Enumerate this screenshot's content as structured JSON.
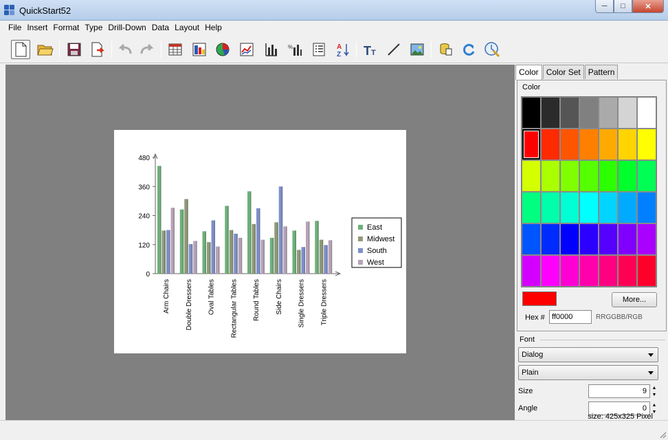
{
  "window": {
    "title": "QuickStart52"
  },
  "menu": [
    "File",
    "Insert",
    "Format",
    "Type",
    "Drill-Down",
    "Data",
    "Layout",
    "Help"
  ],
  "toolbar": {
    "icons": [
      "new-document-icon",
      "open-folder-icon",
      "save-icon",
      "export-icon",
      "undo-icon",
      "redo-icon",
      "table-chart-icon",
      "bar-chart-icon",
      "pie-chart-icon",
      "line-chart-icon",
      "axis-icon",
      "data-labels-icon",
      "legend-icon",
      "sort-icon",
      "text-icon",
      "line-draw-icon",
      "image-icon",
      "database-icon",
      "refresh-icon",
      "wizard-icon"
    ]
  },
  "chart_data": {
    "type": "bar",
    "categories": [
      "Arm Chairs",
      "Double Dressers",
      "Oval Tables",
      "Rectangular Tables",
      "Round Tables",
      "Side Chairs",
      "Single Dressers",
      "Triple Dressers"
    ],
    "series": [
      {
        "name": "East",
        "color": "#6fb07a",
        "values": [
          445,
          265,
          175,
          280,
          340,
          148,
          178,
          218
        ]
      },
      {
        "name": "Midwest",
        "color": "#8f9a7a",
        "values": [
          178,
          308,
          130,
          180,
          205,
          212,
          98,
          140
        ]
      },
      {
        "name": "South",
        "color": "#7f90c8",
        "values": [
          180,
          122,
          220,
          165,
          270,
          360,
          110,
          118
        ]
      },
      {
        "name": "West",
        "color": "#b7a3b7",
        "values": [
          272,
          135,
          112,
          148,
          140,
          195,
          215,
          138
        ]
      }
    ],
    "y_ticks": [
      "0",
      "120",
      "240",
      "360",
      "480"
    ],
    "ylim": [
      0,
      480
    ],
    "legend_position": "right",
    "grid": false
  },
  "panel": {
    "tabs": [
      "Color",
      "Color Set",
      "Pattern"
    ],
    "active_tab": "Color",
    "group_label": "Color",
    "swatches": [
      "#000000",
      "#2b2b2b",
      "#555555",
      "#808080",
      "#aaaaaa",
      "#d4d4d4",
      "#ffffff",
      "#ff0000",
      "#ff2b00",
      "#ff5500",
      "#ff8000",
      "#ffaa00",
      "#ffd400",
      "#ffff00",
      "#d4ff00",
      "#aaff00",
      "#80ff00",
      "#55ff00",
      "#2bff00",
      "#00ff2b",
      "#00ff55",
      "#00ff80",
      "#00ffaa",
      "#00ffd4",
      "#00ffff",
      "#00d4ff",
      "#00aaff",
      "#0080ff",
      "#0055ff",
      "#002bff",
      "#0000ff",
      "#2b00ff",
      "#5500ff",
      "#8000ff",
      "#aa00ff",
      "#d400ff",
      "#ff00ff",
      "#ff00d4",
      "#ff00aa",
      "#ff0080",
      "#ff0055",
      "#ff002b"
    ],
    "selected_color": "#ff0000",
    "more_label": "More...",
    "hex_label": "Hex #",
    "hex_value": "ff0000",
    "hex_hint": "RRGGBB/RGB",
    "font_label": "Font",
    "font_family": "Dialog",
    "font_style": "Plain",
    "size_label": "Size",
    "size_value": "9",
    "angle_label": "Angle",
    "angle_value": "0"
  },
  "status": {
    "text": "size: 425x325 Pixel"
  }
}
